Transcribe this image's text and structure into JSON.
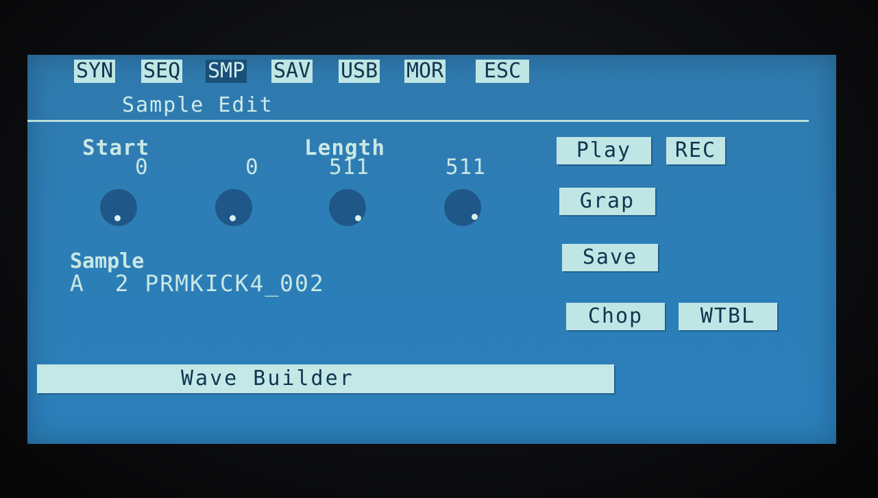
{
  "menu": {
    "tabs": [
      {
        "label": "SYN",
        "active": false
      },
      {
        "label": "SEQ",
        "active": false
      },
      {
        "label": "SMP",
        "active": true
      },
      {
        "label": "SAV",
        "active": false
      },
      {
        "label": "USB",
        "active": false
      },
      {
        "label": "MOR",
        "active": false
      },
      {
        "label": "ESC",
        "active": false
      }
    ]
  },
  "page_title": "Sample Edit",
  "params": {
    "start_label": "Start",
    "length_label": "Length",
    "knobs": [
      {
        "value": "0"
      },
      {
        "value": "0"
      },
      {
        "value": "511"
      },
      {
        "value": "511"
      }
    ]
  },
  "sample": {
    "label": "Sample",
    "bank": "A",
    "number": "2",
    "name": "PRMKICK4_002"
  },
  "buttons": {
    "play": "Play",
    "rec": "REC",
    "grap": "Grap",
    "save": "Save",
    "chop": "Chop",
    "wtbl": "WTBL"
  },
  "wave_builder": "Wave Builder",
  "colors": {
    "screen": "#2d7eb6",
    "highlight": "#bfe6e4",
    "text_dark": "#0f3550",
    "text_light": "#c9e7e4",
    "active_tab": "#1a4f78",
    "knob": "#1f5888"
  }
}
